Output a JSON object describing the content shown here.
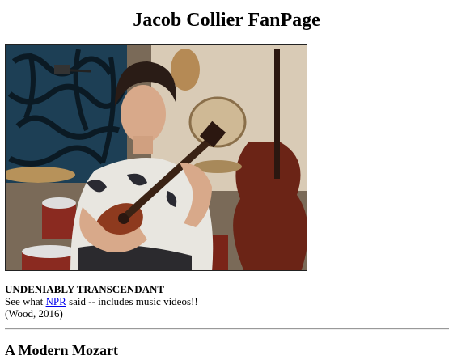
{
  "page": {
    "title": "Jacob Collier FanPage"
  },
  "photo": {
    "subject": "Jacob Collier playing ukulele"
  },
  "caption": {
    "headline": "UNDENIABLY TRANSCENDANT",
    "prefix": "See what ",
    "link_text": "NPR",
    "suffix": " said -- includes music videos!!",
    "citation": "(Wood, 2016)"
  },
  "section": {
    "heading": "A Modern Mozart"
  }
}
